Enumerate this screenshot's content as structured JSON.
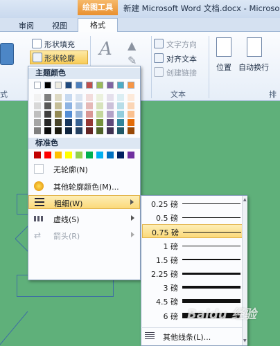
{
  "window": {
    "drawing_tools": "绘图工具",
    "doc_title": "新建 Microsoft Word 文档.docx - Microso"
  },
  "tabs": [
    "审阅",
    "视图",
    "格式"
  ],
  "ribbon": {
    "shape_fill": "形状填充",
    "shape_outline": "形状轮廓",
    "text_direction": "文字方向",
    "align_text": "对齐文本",
    "create_link": "创建链接",
    "text_group": "文本",
    "position": "位置",
    "wrap_text": "自动换行",
    "arrange_group": "排"
  },
  "outline_menu": {
    "theme_colors_header": "主题颜色",
    "standard_colors_header": "标准色",
    "no_outline": "无轮廓(N)",
    "more_colors": "其他轮廓颜色(M)...",
    "weight": "粗细(W)",
    "dashes": "虚线(S)",
    "arrows": "箭头(R)",
    "theme_colors": [
      [
        "#ffffff",
        "#000000",
        "#eeece1",
        "#1f497d",
        "#4f81bd",
        "#c0504d",
        "#9bbb59",
        "#8064a2",
        "#4bacc6",
        "#f79646"
      ],
      [
        "#f2f2f2",
        "#7f7f7f",
        "#ddd9c3",
        "#c6d9f0",
        "#dbe5f1",
        "#f2dcdb",
        "#ebf1dd",
        "#e5e0ec",
        "#dbeef3",
        "#fdeada"
      ],
      [
        "#d8d8d8",
        "#595959",
        "#c4bd97",
        "#8db3e2",
        "#b8cce4",
        "#e5b9b7",
        "#d7e3bc",
        "#ccc1d9",
        "#b7dde8",
        "#fbd5b5"
      ],
      [
        "#bfbfbf",
        "#3f3f3f",
        "#938953",
        "#548dd4",
        "#95b3d7",
        "#d99694",
        "#c3d69b",
        "#b2a2c7",
        "#92cddc",
        "#fac08f"
      ],
      [
        "#a5a5a5",
        "#262626",
        "#494429",
        "#17365d",
        "#366092",
        "#953734",
        "#76923c",
        "#5f497a",
        "#31859b",
        "#e36c09"
      ],
      [
        "#7f7f7f",
        "#0c0c0c",
        "#1d1b10",
        "#0f243e",
        "#244061",
        "#632423",
        "#4f6128",
        "#3f3151",
        "#205867",
        "#974806"
      ]
    ],
    "standard_colors": [
      "#c00000",
      "#ff0000",
      "#ffc000",
      "#ffff00",
      "#92d050",
      "#00b050",
      "#00b0f0",
      "#0070c0",
      "#002060",
      "#7030a0"
    ]
  },
  "weight_menu": {
    "items": [
      {
        "label": "0.25 磅",
        "pt": 0.25
      },
      {
        "label": "0.5 磅",
        "pt": 0.5
      },
      {
        "label": "0.75 磅",
        "pt": 0.75
      },
      {
        "label": "1 磅",
        "pt": 1
      },
      {
        "label": "1.5 磅",
        "pt": 1.5
      },
      {
        "label": "2.25 磅",
        "pt": 2.25
      },
      {
        "label": "3 磅",
        "pt": 3
      },
      {
        "label": "4.5 磅",
        "pt": 4.5
      },
      {
        "label": "6 磅",
        "pt": 6
      }
    ],
    "selected": "0.75 磅",
    "more_lines": "其他线条(L)..."
  },
  "watermark": "Baidu 经验"
}
